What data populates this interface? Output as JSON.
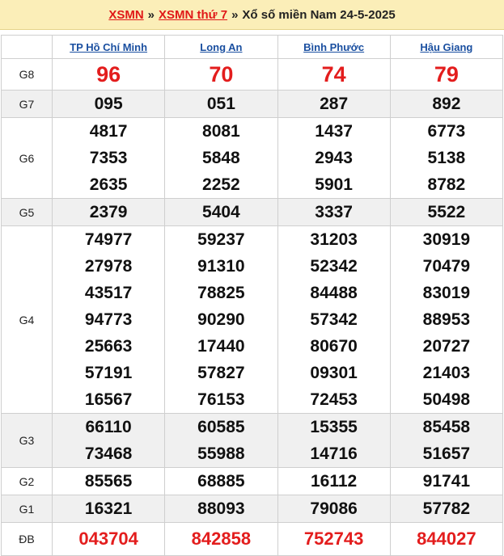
{
  "header": {
    "link1": "XSMN",
    "sep1": "»",
    "link2": "XSMN thứ 7",
    "sep2": "»",
    "title": "Xổ số miền Nam 24-5-2025"
  },
  "provinces": [
    "TP Hồ Chí Minh",
    "Long An",
    "Bình Phước",
    "Hậu Giang"
  ],
  "prizes": [
    {
      "label": "G8",
      "cols": [
        [
          "96"
        ],
        [
          "70"
        ],
        [
          "74"
        ],
        [
          "79"
        ]
      ]
    },
    {
      "label": "G7",
      "cols": [
        [
          "095"
        ],
        [
          "051"
        ],
        [
          "287"
        ],
        [
          "892"
        ]
      ]
    },
    {
      "label": "G6",
      "cols": [
        [
          "4817",
          "7353",
          "2635"
        ],
        [
          "8081",
          "5848",
          "2252"
        ],
        [
          "1437",
          "2943",
          "5901"
        ],
        [
          "6773",
          "5138",
          "8782"
        ]
      ]
    },
    {
      "label": "G5",
      "cols": [
        [
          "2379"
        ],
        [
          "5404"
        ],
        [
          "3337"
        ],
        [
          "5522"
        ]
      ]
    },
    {
      "label": "G4",
      "cols": [
        [
          "74977",
          "27978",
          "43517",
          "94773",
          "25663",
          "57191",
          "16567"
        ],
        [
          "59237",
          "91310",
          "78825",
          "90290",
          "17440",
          "57827",
          "76153"
        ],
        [
          "31203",
          "52342",
          "84488",
          "57342",
          "80670",
          "09301",
          "72453"
        ],
        [
          "30919",
          "70479",
          "83019",
          "88953",
          "20727",
          "21403",
          "50498"
        ]
      ]
    },
    {
      "label": "G3",
      "cols": [
        [
          "66110",
          "73468"
        ],
        [
          "60585",
          "55988"
        ],
        [
          "15355",
          "14716"
        ],
        [
          "85458",
          "51657"
        ]
      ]
    },
    {
      "label": "G2",
      "cols": [
        [
          "85565"
        ],
        [
          "68885"
        ],
        [
          "16112"
        ],
        [
          "91741"
        ]
      ]
    },
    {
      "label": "G1",
      "cols": [
        [
          "16321"
        ],
        [
          "88093"
        ],
        [
          "79086"
        ],
        [
          "57782"
        ]
      ]
    },
    {
      "label": "ĐB",
      "cols": [
        [
          "043704"
        ],
        [
          "842858"
        ],
        [
          "752743"
        ],
        [
          "844027"
        ]
      ]
    }
  ],
  "colors": {
    "highlight": "#e31d1d",
    "header_bg": "#fbeeb8",
    "link": "#1a4fa0"
  }
}
